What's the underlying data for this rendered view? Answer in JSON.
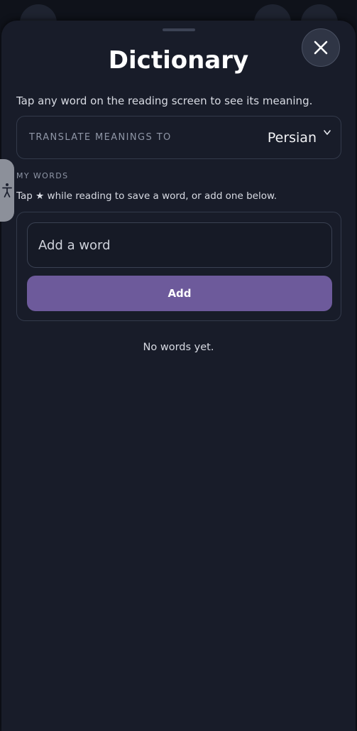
{
  "sheet": {
    "title": "Dictionary",
    "hint": "Tap any word on the reading screen to see its meaning."
  },
  "translate": {
    "label": "TRANSLATE MEANINGS TO",
    "selected_language": "Persian",
    "chevron_icon": "chevron-down-icon"
  },
  "my_words": {
    "section_label": "MY WORDS",
    "hint": "Tap ★ while reading to save a word, or add one below.",
    "input_placeholder": "Add a word",
    "input_value": "",
    "add_button_label": "Add",
    "empty_message": "No words yet."
  },
  "icons": {
    "close": "close-icon",
    "accessibility": "accessibility-icon"
  },
  "colors": {
    "sheet_background": "#181c29",
    "accent": "#6d5a9b",
    "text_primary": "#ffffff",
    "text_muted": "#8f96a6"
  }
}
